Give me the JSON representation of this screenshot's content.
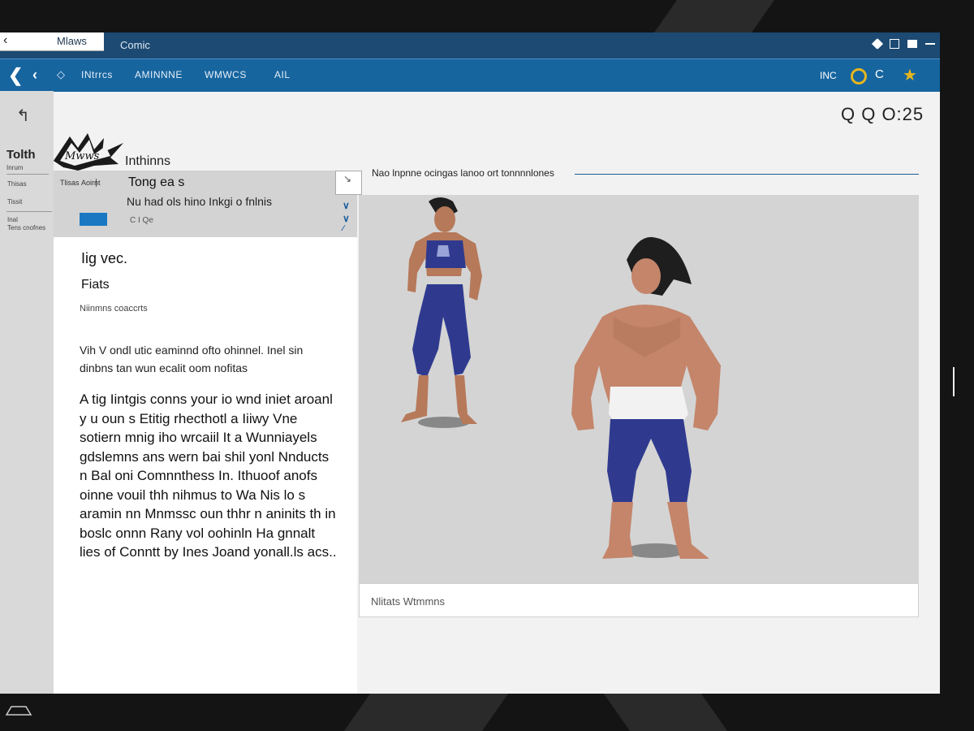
{
  "window": {
    "tabs": [
      {
        "label": "Mlaws",
        "active": true
      },
      {
        "label": "Comic",
        "active": false
      }
    ]
  },
  "nav": {
    "links": [
      "INtrrcs",
      "AMINNNE",
      "WMWCS",
      "AIL"
    ],
    "right_text": "INC",
    "right_letter": "C",
    "icons": [
      "back-arrow",
      "back-arrow",
      "diamond",
      "ring",
      "star"
    ],
    "accent_color": "#e6b51f",
    "bar_color": "#17659f",
    "title_color": "#1c4a73"
  },
  "sidebar": {
    "title": "Tolth",
    "subtitle": "Inrum",
    "items": [
      "Thisas",
      "Tissit",
      "Inal",
      "Tens cnofnes"
    ]
  },
  "timer": "Q Q O:25",
  "section_heading": "Inthinns",
  "panel": {
    "col1": "Tlisas",
    "col2": "Aoirnt",
    "heading": "Tong ea s",
    "subheading": "Nu had ols hino Inkgi o fnlnis",
    "small_text": "C I Qe"
  },
  "card": {
    "heading": "Iig vec.",
    "subheading": "Fiats",
    "small": "Niinmns coaccrts",
    "paragraph1": "Vih V ondl utic eaminnd ofto ohinnel. Inel sin dinbns tan wun ecalit oom nofitas",
    "paragraph2": "A tig Iintgis conns your io wnd iniet aroanl y u oun s Etitig rhecthotl a Iiiwy Vne sotiern mnig iho wrcaiil It a Wunniayels gdslemns ans wern bai shil yonl Nnducts n Bal oni Comnnthess In. Ithuoof anofs oinne vouil thh nihmus to Wa Nis lo s aramin nn Mnmssc oun thhr n aninits th in boslc onnn Rany vol oohinln Ha gnnalt lies of Conntt by Ines Joand yonall.ls acs.."
  },
  "image_area": {
    "heading": "Nao lnpnne ocingas lanoo ort tonnnnlones",
    "caption": "Nlitats Wtmmns",
    "background": "#d4d4d4"
  }
}
